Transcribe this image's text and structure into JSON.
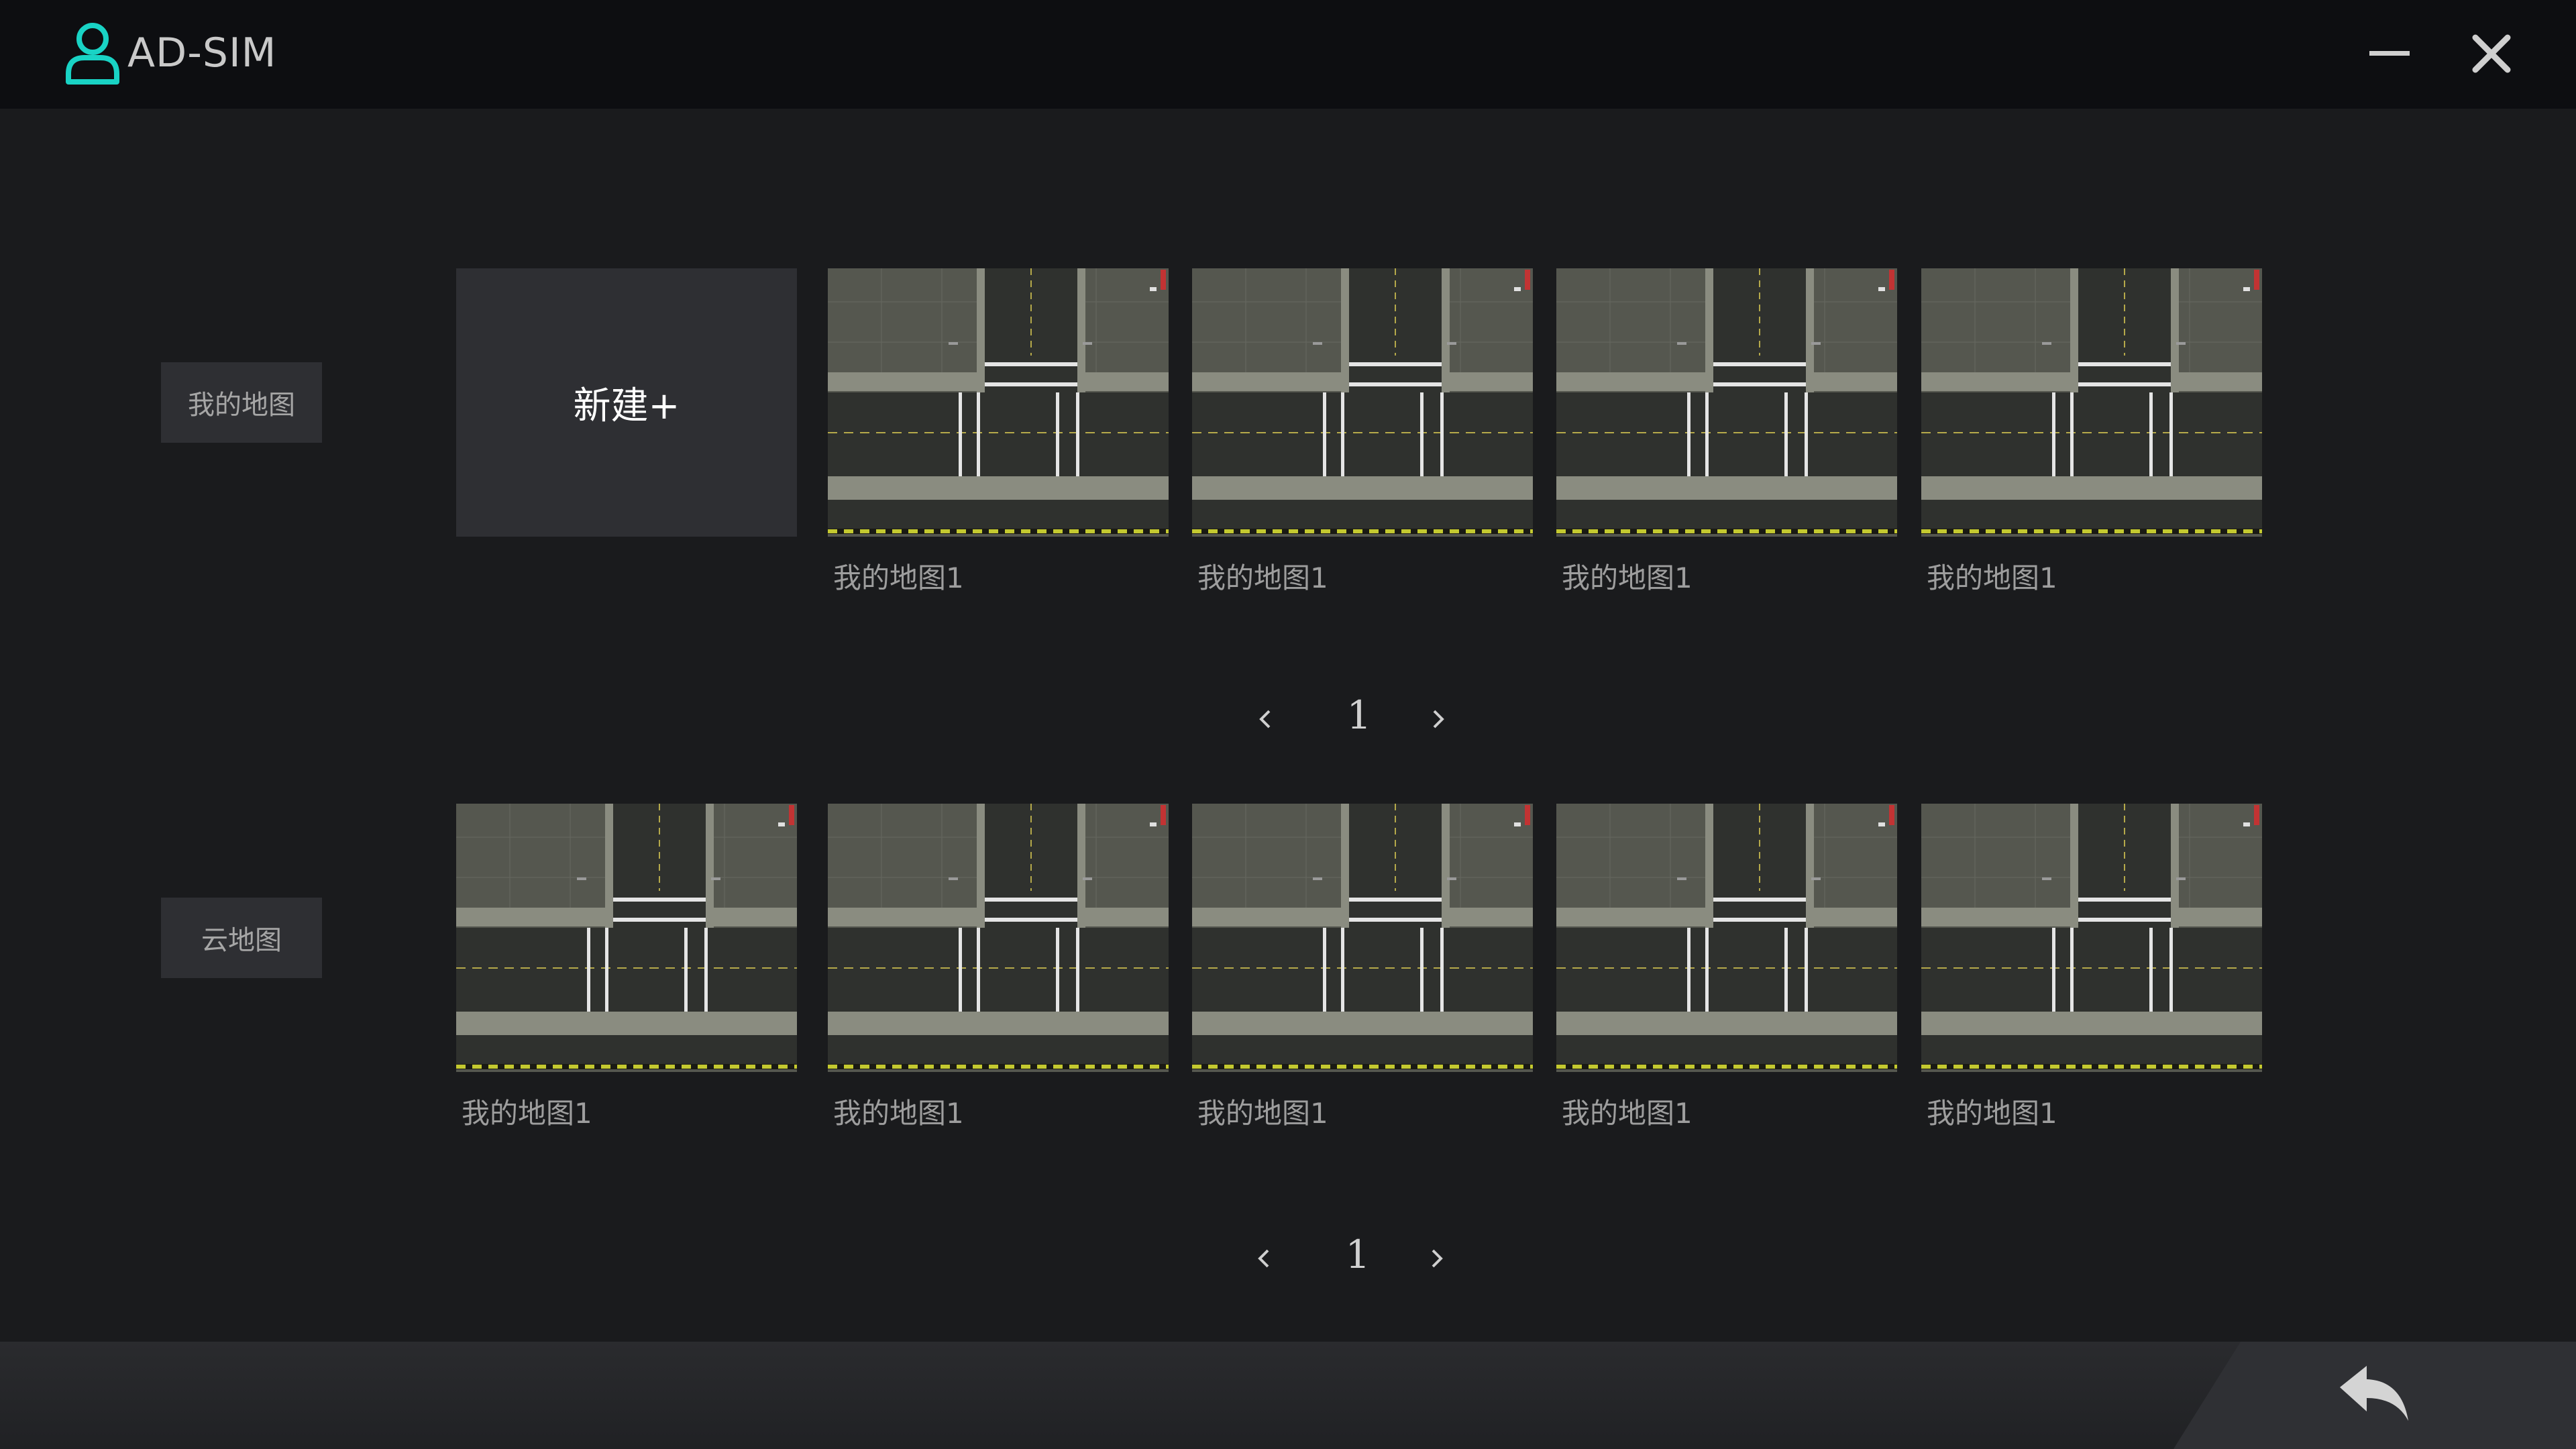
{
  "window": {
    "title": "AD-SIM",
    "accent_color": "#19d3c5",
    "icons": {
      "logo": "user-icon",
      "minimize": "minimize-icon",
      "close": "close-icon",
      "back": "back-arrow-icon"
    }
  },
  "my_maps": {
    "label": "我的地图",
    "new_button_label": "新建+",
    "items": [
      {
        "name": "我的地图1"
      },
      {
        "name": "我的地图1"
      },
      {
        "name": "我的地图1"
      },
      {
        "name": "我的地图1"
      }
    ],
    "pagination": {
      "page": "1",
      "prev_icon": "chevron-left-icon",
      "next_icon": "chevron-right-icon"
    }
  },
  "cloud_maps": {
    "label": "云地图",
    "items": [
      {
        "name": "我的地图1"
      },
      {
        "name": "我的地图1"
      },
      {
        "name": "我的地图1"
      },
      {
        "name": "我的地图1"
      },
      {
        "name": "我的地图1"
      }
    ],
    "pagination": {
      "page": "1",
      "prev_icon": "chevron-left-icon",
      "next_icon": "chevron-right-icon"
    }
  }
}
